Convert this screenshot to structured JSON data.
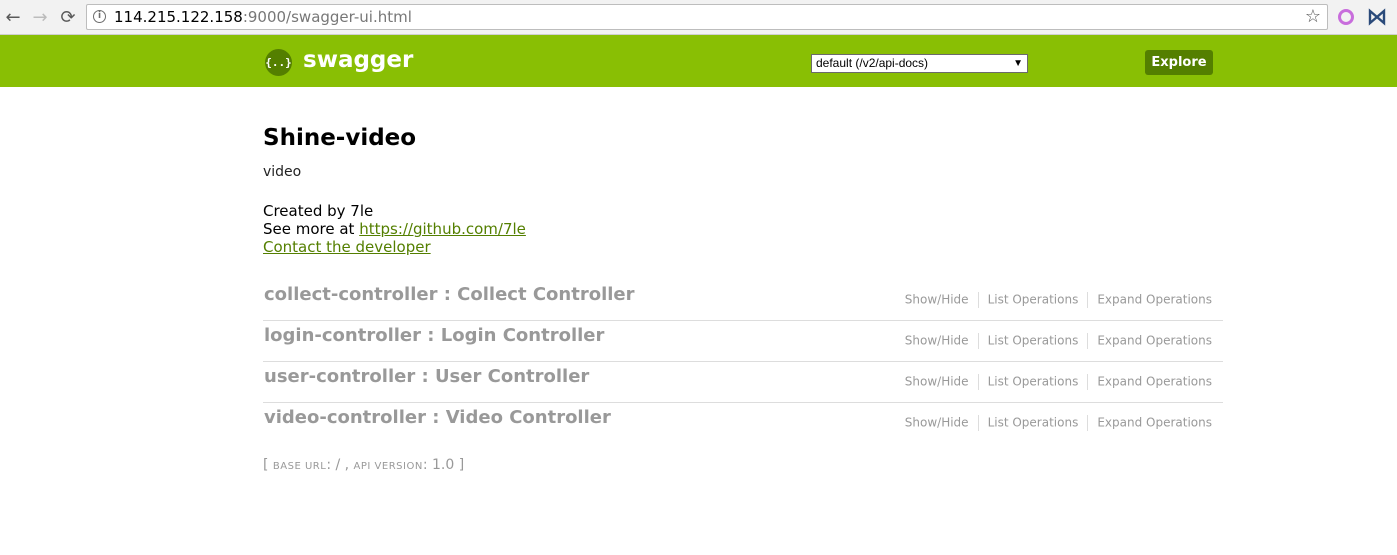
{
  "browser": {
    "url_host": "114.215.122.158",
    "url_rest": ":9000/swagger-ui.html",
    "back_glyph": "←",
    "forward_glyph": "→",
    "reload_glyph": "⟳",
    "star_glyph": "☆",
    "info_glyph": "i",
    "icons": [
      "back-arrow-icon",
      "forward-arrow-icon",
      "reload-icon",
      "info-icon",
      "star-icon",
      "extension-ring-icon",
      "extension-bowtie-icon"
    ]
  },
  "header": {
    "logo_glyph": "{..}",
    "logo_text": "swagger",
    "spec_selected": "default (/v2/api-docs)",
    "spec_arrow": "▼",
    "explore_label": "Explore",
    "colors": {
      "bar": "#89bf04",
      "dark": "#547f00"
    }
  },
  "info": {
    "title": "Shine-video",
    "description": "video",
    "created_by": "Created by 7le",
    "see_more_prefix": "See more at ",
    "see_more_link": "https://github.com/7le",
    "contact_link": "Contact the developer"
  },
  "resources": [
    {
      "name": "collect-controller : Collect Controller",
      "show_hide": "Show/Hide",
      "list_ops": "List Operations",
      "expand_ops": "Expand Operations"
    },
    {
      "name": "login-controller : Login Controller",
      "show_hide": "Show/Hide",
      "list_ops": "List Operations",
      "expand_ops": "Expand Operations"
    },
    {
      "name": "user-controller : User Controller",
      "show_hide": "Show/Hide",
      "list_ops": "List Operations",
      "expand_ops": "Expand Operations"
    },
    {
      "name": "video-controller : Video Controller",
      "show_hide": "Show/Hide",
      "list_ops": "List Operations",
      "expand_ops": "Expand Operations"
    }
  ],
  "footer": {
    "open": "[ ",
    "base_url_label": "BASE URL",
    "base_url_value": ": / , ",
    "api_version_label": "API VERSION",
    "api_version_value": ": 1.0 ]"
  }
}
